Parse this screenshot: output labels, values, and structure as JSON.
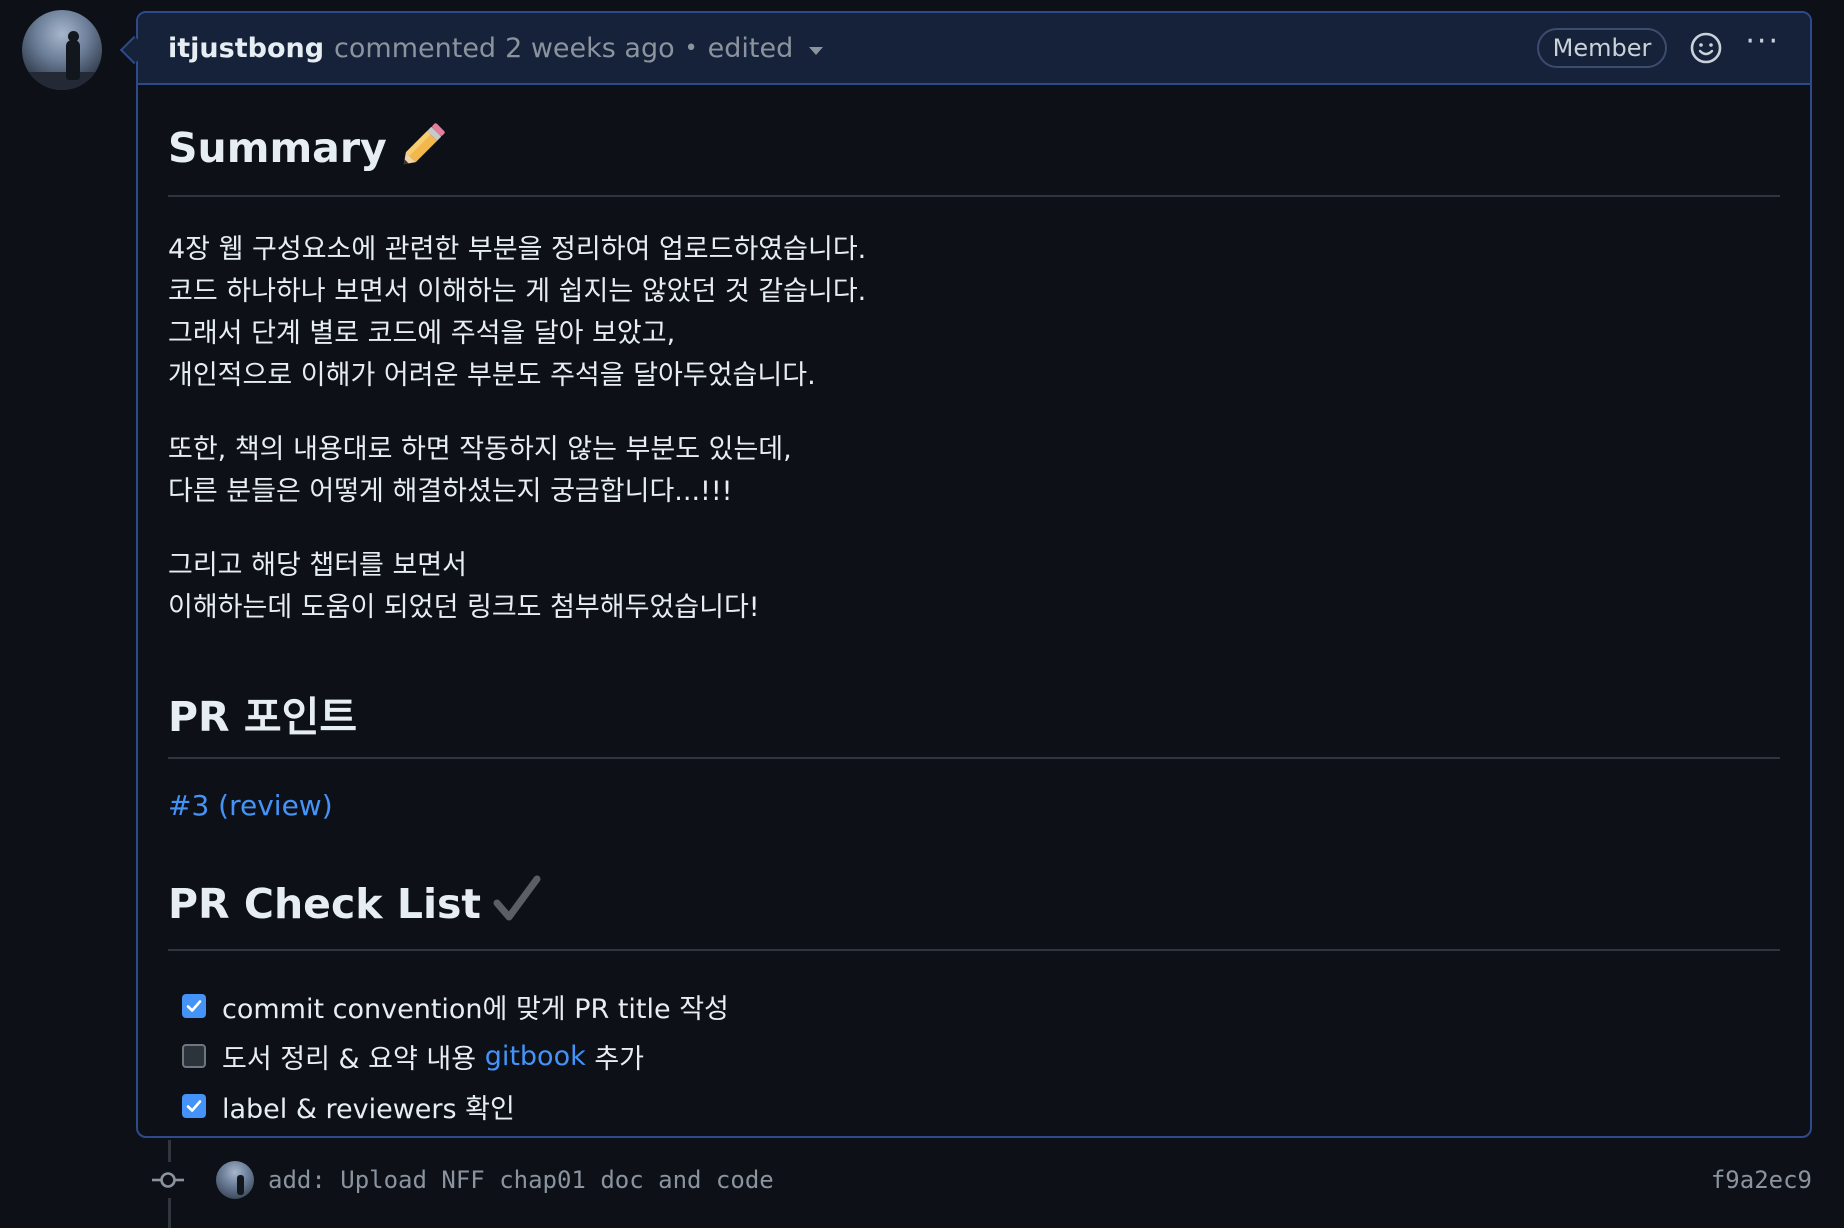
{
  "comment": {
    "author": "itjustbong",
    "action": "commented",
    "time": "2 weeks ago",
    "separator": "•",
    "edited": "edited",
    "badge": "Member",
    "more_label": "···"
  },
  "body": {
    "summary_heading": "Summary",
    "summary_paragraph_1": [
      "4장 웹 구성요소에 관련한 부분을 정리하여 업로드하였습니다.",
      "코드 하나하나 보면서 이해하는 게 쉽지는 않았던 것 같습니다.",
      "그래서 단계 별로 코드에 주석을 달아 보았고,",
      "개인적으로 이해가 어려운 부분도 주석을 달아두었습니다."
    ],
    "summary_paragraph_2": [
      "또한, 책의 내용대로 하면 작동하지 않는 부분도 있는데,",
      "다른 분들은 어떻게 해결하셨는지 궁금합니다...!!!"
    ],
    "summary_paragraph_3": [
      "그리고 해당 챕터를 보면서",
      "이해하는데 도움이 되었던 링크도 첨부해두었습니다!"
    ],
    "pr_point_heading": "PR 포인트",
    "pr_point_link": "#3 (review)",
    "checklist_heading": "PR Check List",
    "checklist": [
      {
        "checked": true,
        "before": "commit convention에 맞게 PR title 작성",
        "link": "",
        "after": ""
      },
      {
        "checked": false,
        "before": "도서 정리 & 요약 내용 ",
        "link": "gitbook",
        "after": " 추가"
      },
      {
        "checked": true,
        "before": "label & reviewers 확인",
        "link": "",
        "after": ""
      }
    ]
  },
  "commit": {
    "message": "add: Upload NFF chap01 doc and code",
    "sha": "f9a2ec9"
  },
  "colors": {
    "accent": "#4493f8",
    "header_bg": "#15223a",
    "border": "#2f4a8a",
    "page_bg": "#0d1117"
  }
}
